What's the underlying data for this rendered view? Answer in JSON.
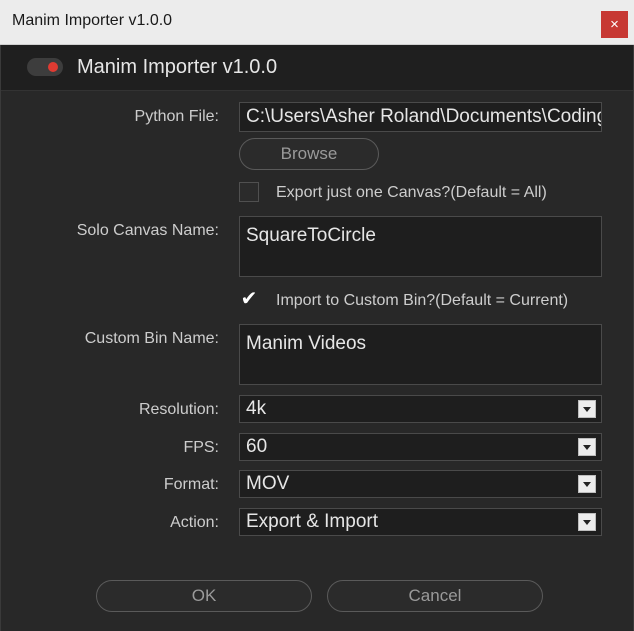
{
  "window": {
    "title": "Manim Importer v1.0.0",
    "close_glyph": "×"
  },
  "header": {
    "title": "Manim Importer v1.0.0",
    "toggle_on": true
  },
  "python_file": {
    "label": "Python File:",
    "value": "C:\\Users\\Asher Roland\\Documents\\Coding"
  },
  "browse_label": "Browse",
  "export_one": {
    "label": "Export just one Canvas?(Default = All)",
    "checked": false
  },
  "solo_canvas": {
    "label": "Solo Canvas Name:",
    "value": "SquareToCircle"
  },
  "custom_bin_check": {
    "label": "Import to Custom Bin?(Default = Current)",
    "checked": true,
    "glyph": "✔"
  },
  "custom_bin": {
    "label": "Custom Bin Name:",
    "value": "Manim Videos"
  },
  "resolution": {
    "label": "Resolution:",
    "value": "4k"
  },
  "fps": {
    "label": "FPS:",
    "value": "60"
  },
  "format": {
    "label": "Format:",
    "value": "MOV"
  },
  "action": {
    "label": "Action:",
    "value": "Export & Import"
  },
  "ok_label": "OK",
  "cancel_label": "Cancel",
  "colors": {
    "accent_red": "#e03b32",
    "close_red": "#c73833",
    "background": "#282828"
  }
}
